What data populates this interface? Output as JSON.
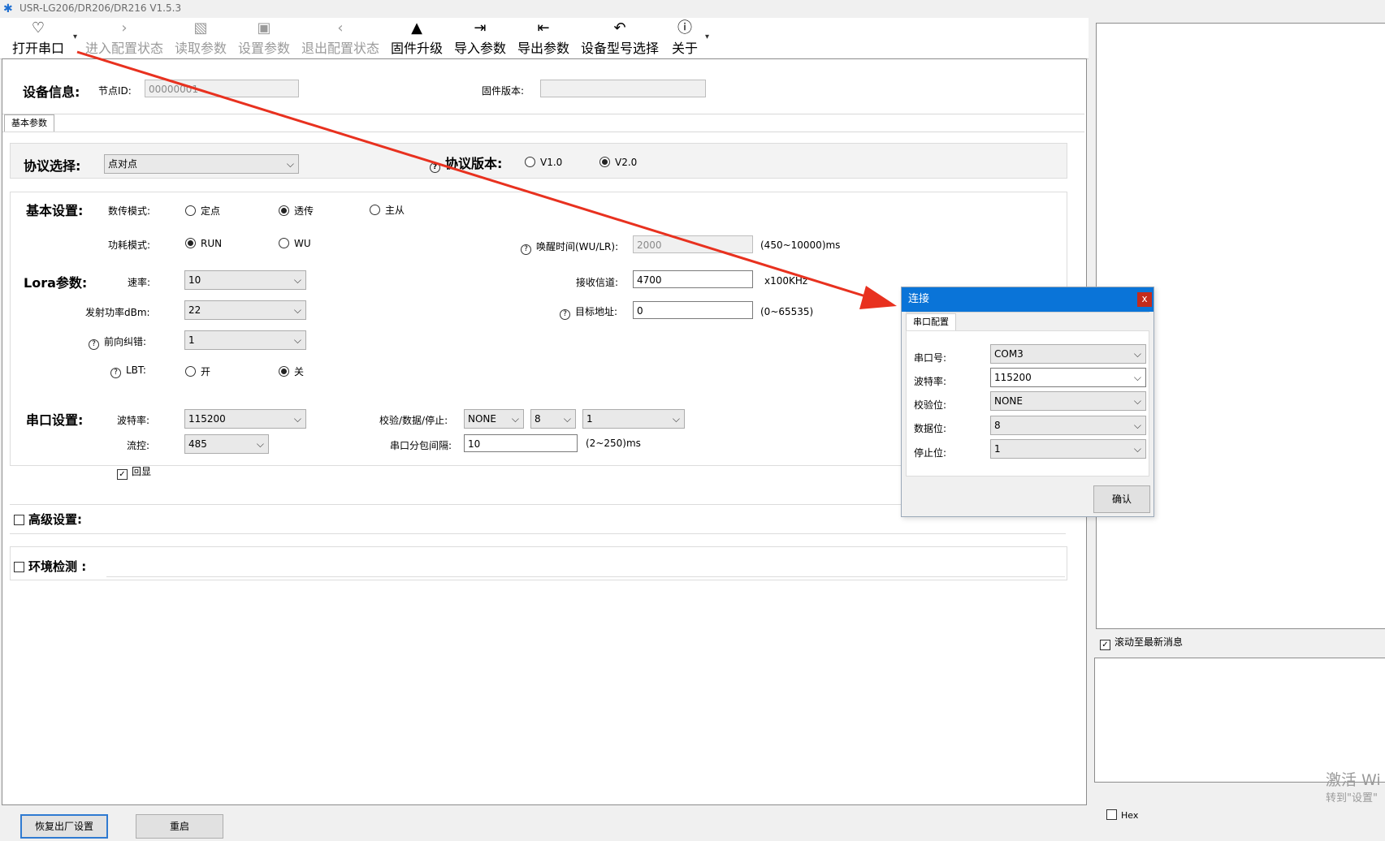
{
  "window": {
    "title": "USR-LG206/DR206/DR216 V1.5.3"
  },
  "toolbar": {
    "open_port": "打开串口",
    "enter_config": "进入配置状态",
    "read_params": "读取参数",
    "set_params": "设置参数",
    "exit_config": "退出配置状态",
    "firmware_upgrade": "固件升级",
    "import_params": "导入参数",
    "export_params": "导出参数",
    "model_select": "设备型号选择",
    "about": "关于"
  },
  "device_info": {
    "heading": "设备信息:",
    "node_id_label": "节点ID:",
    "node_id_value": "00000001",
    "firmware_label": "固件版本:",
    "firmware_value": ""
  },
  "tabs": {
    "basic": "基本参数"
  },
  "protocol": {
    "label": "协议选择:",
    "selected": "点对点",
    "version_label": "协议版本:",
    "v1": "V1.0",
    "v2": "V2.0"
  },
  "basic": {
    "heading": "基本设置:",
    "mode_label": "数传模式:",
    "mode_fixed": "定点",
    "mode_transparent": "透传",
    "mode_master": "主从",
    "power_label": "功耗模式:",
    "power_run": "RUN",
    "power_wu": "WU",
    "wake_label": "唤醒时间(WU/LR):",
    "wake_value": "2000",
    "wake_range": "(450~10000)ms"
  },
  "lora": {
    "heading": "Lora参数:",
    "rate_label": "速率:",
    "rate_value": "10",
    "channel_label": "接收信道:",
    "channel_value": "4700",
    "channel_unit": "x100KHz",
    "power_label": "发射功率dBm:",
    "power_value": "22",
    "target_label": "目标地址:",
    "target_value": "0",
    "target_range": "(0~65535)",
    "fec_label": "前向纠错:",
    "fec_value": "1",
    "lbt_label": "LBT:",
    "lbt_on": "开",
    "lbt_off": "关"
  },
  "serial": {
    "heading": "串口设置:",
    "baud_label": "波特率:",
    "baud_value": "115200",
    "parity_label": "校验/数据/停止:",
    "parity_value": "NONE",
    "data_value": "8",
    "stop_value": "1",
    "flow_label": "流控:",
    "flow_value": "485",
    "interval_label": "串口分包间隔:",
    "interval_value": "10",
    "interval_range": "(2~250)ms",
    "echo_label": "回显"
  },
  "advanced": {
    "label": "高级设置:"
  },
  "env": {
    "label": "环境检测 :"
  },
  "footer": {
    "factory_reset": "恢复出厂设置",
    "restart": "重启"
  },
  "side": {
    "scroll_latest": "滚动至最新消息",
    "hex": "Hex"
  },
  "dialog": {
    "title": "连接",
    "close": "x",
    "tab": "串口配置",
    "port_label": "串口号:",
    "port_value": "COM3",
    "baud_label": "波特率:",
    "baud_value": "115200",
    "parity_label": "校验位:",
    "parity_value": "NONE",
    "data_label": "数据位:",
    "data_value": "8",
    "stop_label": "停止位:",
    "stop_value": "1",
    "confirm": "确认"
  },
  "watermark": {
    "line1": "激活 Wi",
    "line2": "转到\"设置\""
  },
  "colors": {
    "accent": "#0a74d8",
    "arrow": "#e8311f",
    "close": "#c42b1c"
  }
}
